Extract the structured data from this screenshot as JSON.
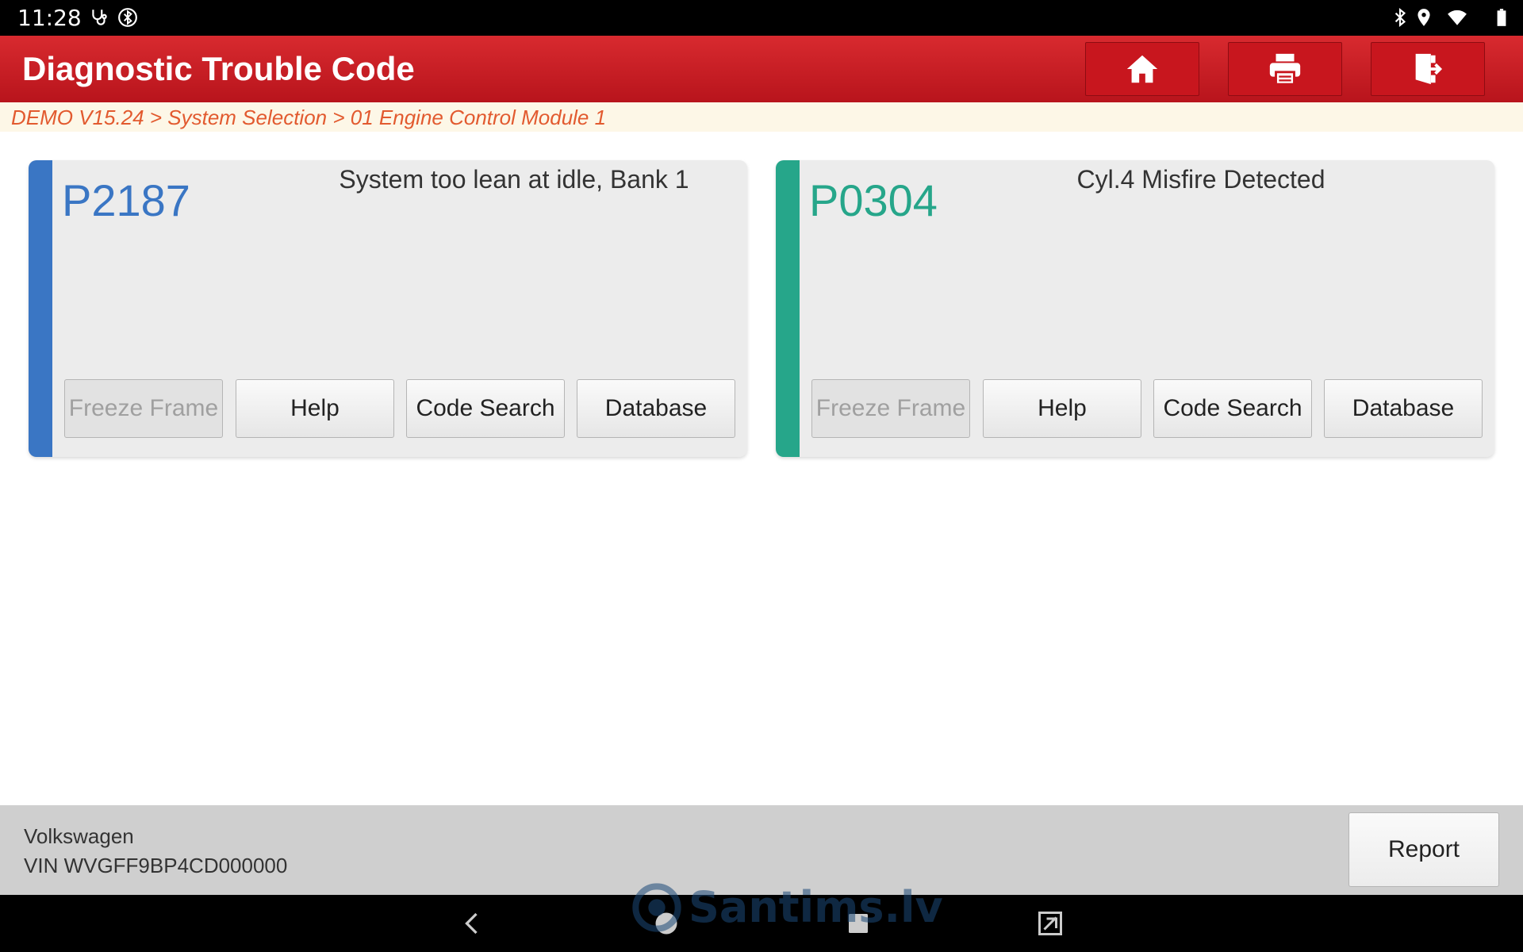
{
  "status_bar": {
    "time": "11:28",
    "left_icons": [
      "stethoscope-icon",
      "bluetooth-scan-icon"
    ],
    "right_icons": [
      "bluetooth-icon",
      "location-icon",
      "wifi-icon",
      "battery-icon"
    ]
  },
  "header": {
    "title": "Diagnostic Trouble Code",
    "buttons": [
      "home-icon",
      "print-icon",
      "exit-icon"
    ],
    "color": "#c8161e"
  },
  "breadcrumb": {
    "text": "DEMO V15.24 > System Selection > 01 Engine Control Module 1"
  },
  "dtcs": [
    {
      "code": "P2187",
      "description": "System too lean at idle, Bank 1",
      "accent_color": "#3a76c4",
      "buttons": {
        "freeze_frame": "Freeze Frame",
        "help": "Help",
        "code_search": "Code Search",
        "database": "Database"
      }
    },
    {
      "code": "P0304",
      "description": "Cyl.4 Misfire Detected",
      "accent_color": "#26a68a",
      "buttons": {
        "freeze_frame": "Freeze Frame",
        "help": "Help",
        "code_search": "Code Search",
        "database": "Database"
      }
    }
  ],
  "footer": {
    "make": "Volkswagen",
    "vin": "VIN WVGFF9BP4CD000000",
    "report_label": "Report"
  },
  "nav_bar": {
    "icons": [
      "back-icon",
      "home-circle-icon",
      "recents-square-icon",
      "screenshot-icon"
    ]
  },
  "watermark": {
    "text": "Santims.lv"
  }
}
